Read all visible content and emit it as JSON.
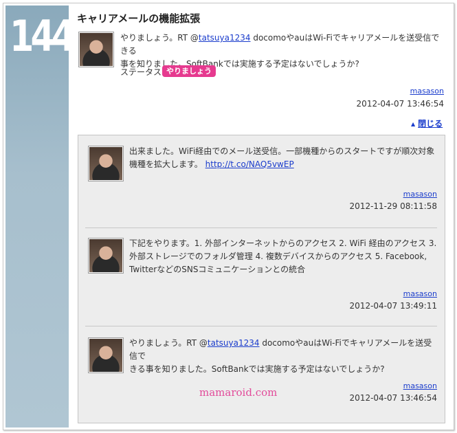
{
  "post": {
    "number": "144",
    "title": "キャリアメールの機能拡張",
    "body_prefix": "やりましょう。RT @",
    "mention": "tatsuya1234",
    "body_suffix_line1": " docomoやauはWi-Fiでキャリアメールを送受信できる",
    "body_line2": "事を知りました。SoftBankでは実施する予定はないでしょうか?",
    "status_label": "ステータス:",
    "status_value": "やりましょう",
    "author": "masason",
    "date": "2012-04-07 13:46:54",
    "close_label": "閉じる"
  },
  "replies": [
    {
      "line1": "出来ました。WiFi経由でのメール送受信。一部機種からのスタートですが順次対象",
      "line2_prefix": "機種を拡大します。",
      "link": "http://t.co/NAQ5vwEP",
      "author": "masason",
      "date": "2012-11-29 08:11:58"
    },
    {
      "line1": "下記をやります。1. 外部インターネットからのアクセス 2. WiFi 経由のアクセス 3.",
      "line2": "外部ストレージでのフォルダ管理 4. 複数デバイスからのアクセス 5. Facebook,",
      "line3": "TwitterなどのSNSコミュニケーションとの統合",
      "author": "masason",
      "date": "2012-04-07 13:49:11"
    },
    {
      "line1_prefix": "やりましょう。RT @",
      "mention": "tatsuya1234",
      "line1_suffix": " docomoやauはWi-Fiでキャリアメールを送受信で",
      "line2": "きる事を知りました。SoftBankでは実施する予定はないでしょうか?",
      "author": "masason",
      "date": "2012-04-07 13:46:54"
    }
  ],
  "watermark": "mamaroid.com",
  "colors": {
    "rail": "#a7bfcd",
    "badge": "#e63a8f",
    "link": "#1a3ccc",
    "thread_bg": "#ededed"
  }
}
